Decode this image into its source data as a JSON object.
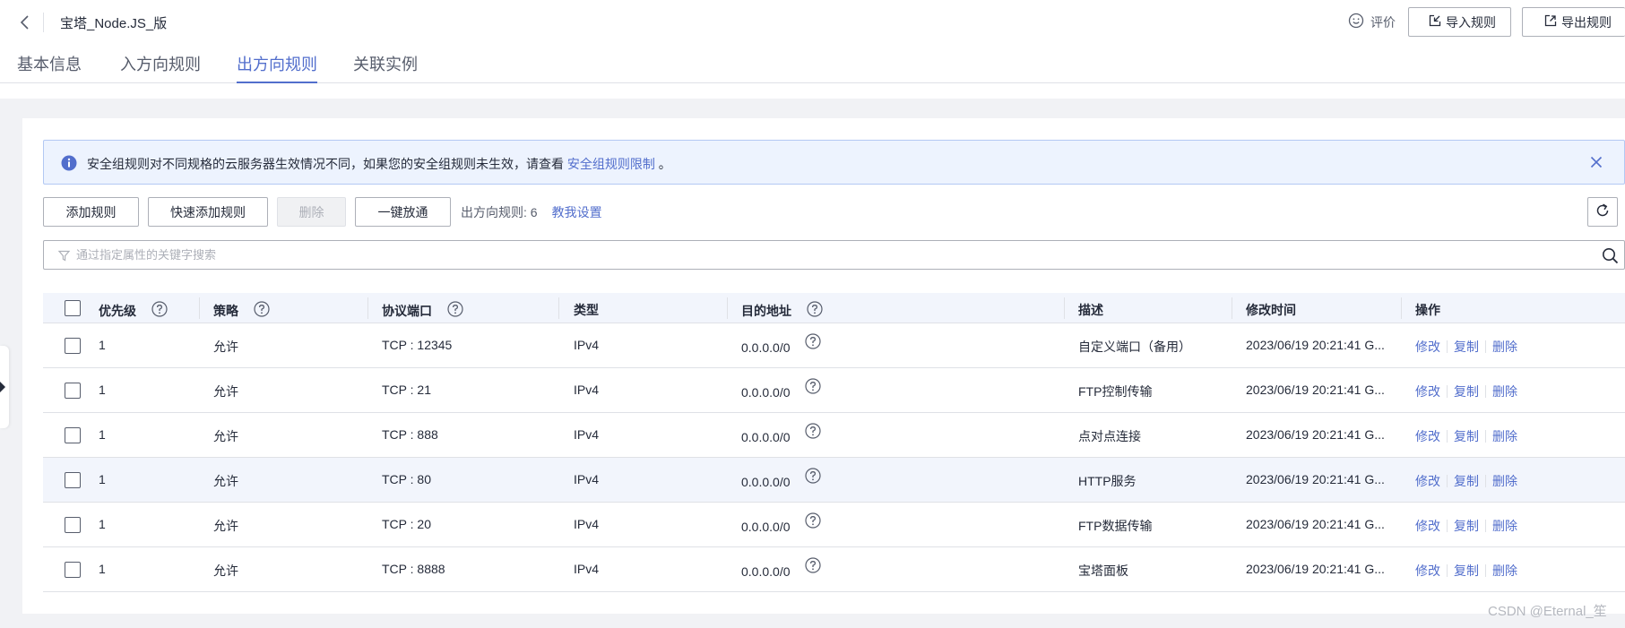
{
  "header": {
    "title": "宝塔_Node.JS_版",
    "rate_label": "评价",
    "import_label": "导入规则",
    "export_label": "导出规则"
  },
  "tabs": [
    {
      "label": "基本信息",
      "active": false
    },
    {
      "label": "入方向规则",
      "active": false
    },
    {
      "label": "出方向规则",
      "active": true
    },
    {
      "label": "关联实例",
      "active": false
    }
  ],
  "notice": {
    "text": "安全组规则对不同规格的云服务器生效情况不同，如果您的安全组规则未生效，请查看",
    "link": "安全组规则限制",
    "suffix": "。"
  },
  "toolbar": {
    "add_label": "添加规则",
    "quick_add_label": "快速添加规则",
    "delete_label": "删除",
    "allow_all_label": "一键放通",
    "count_text": "出方向规则: 6",
    "help_label": "教我设置"
  },
  "search": {
    "placeholder": "通过指定属性的关键字搜索"
  },
  "table": {
    "headers": {
      "priority": "优先级",
      "policy": "策略",
      "protocol_port": "协议端口",
      "type": "类型",
      "destination": "目的地址",
      "description": "描述",
      "modified": "修改时间",
      "actions": "操作"
    },
    "action_labels": {
      "edit": "修改",
      "copy": "复制",
      "delete": "删除"
    },
    "rows": [
      {
        "priority": "1",
        "policy": "允许",
        "protocol_port": "TCP : 12345",
        "type": "IPv4",
        "destination": "0.0.0.0/0",
        "description": "自定义端口（备用）",
        "modified": "2023/06/19 20:21:41 G..."
      },
      {
        "priority": "1",
        "policy": "允许",
        "protocol_port": "TCP : 21",
        "type": "IPv4",
        "destination": "0.0.0.0/0",
        "description": "FTP控制传输",
        "modified": "2023/06/19 20:21:41 G..."
      },
      {
        "priority": "1",
        "policy": "允许",
        "protocol_port": "TCP : 888",
        "type": "IPv4",
        "destination": "0.0.0.0/0",
        "description": "点对点连接",
        "modified": "2023/06/19 20:21:41 G..."
      },
      {
        "priority": "1",
        "policy": "允许",
        "protocol_port": "TCP : 80",
        "type": "IPv4",
        "destination": "0.0.0.0/0",
        "description": "HTTP服务",
        "modified": "2023/06/19 20:21:41 G..."
      },
      {
        "priority": "1",
        "policy": "允许",
        "protocol_port": "TCP : 20",
        "type": "IPv4",
        "destination": "0.0.0.0/0",
        "description": "FTP数据传输",
        "modified": "2023/06/19 20:21:41 G..."
      },
      {
        "priority": "1",
        "policy": "允许",
        "protocol_port": "TCP : 8888",
        "type": "IPv4",
        "destination": "0.0.0.0/0",
        "description": "宝塔面板",
        "modified": "2023/06/19 20:21:41 G..."
      }
    ]
  },
  "watermark": "CSDN @Eternal_笙",
  "colors": {
    "accent": "#526ecc",
    "notice_bg": "#edf3fe",
    "header_bg": "#f2f5fc"
  }
}
